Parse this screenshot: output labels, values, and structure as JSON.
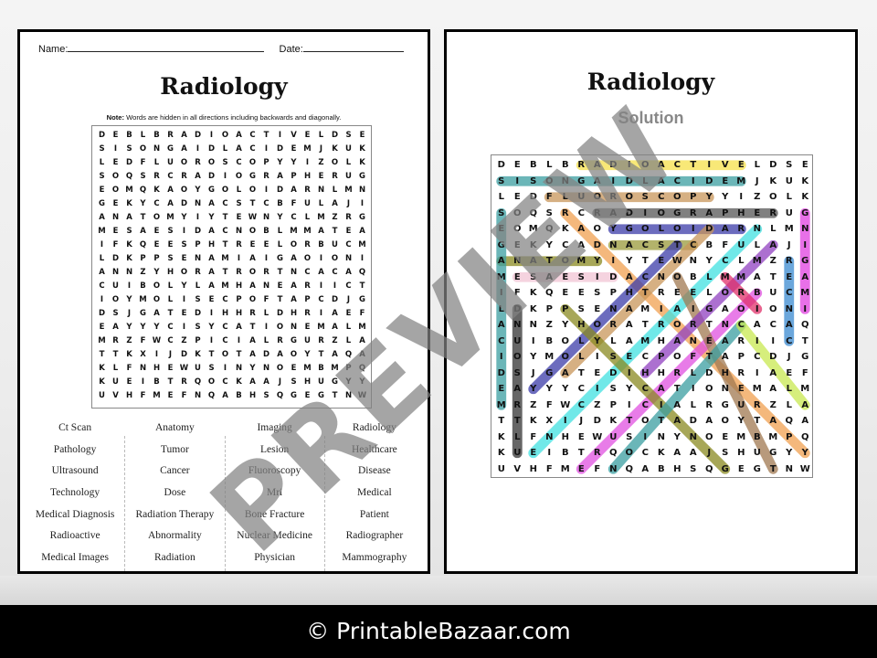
{
  "worksheet": {
    "name_label": "Name:",
    "date_label": "Date:",
    "title": "Radiology",
    "note_bold": "Note:",
    "note_text": " Words are hidden in all directions including backwards and diagonally.",
    "grid": [
      "DEBLBRADIOACTIVELDSE",
      "SISONGAIDLACIDEMJKUK",
      "LEDFLUOROSCOPYYIZOLK",
      "SOQSRCRADIOGRAPHERUG",
      "EOMQKAOYGOLOIDARNLMN",
      "GEKYCADNACSTCBFULAJI",
      "ANATOMYIYTEWNYCLMZRG",
      "MESAESIDACNOBLMMATEA",
      "IFKQEESPHTREELORBUCM",
      "LDKPPSENAMIAIGAOIONI",
      "ANNZYHORATRORTNCACAQ",
      "CUIBOLYLAMHANEARIICT",
      "IOYMOLISECPOFTAPCDJG",
      "DSJGATEDIHHRLDHRIAEF",
      "EAYYYCISYCATIONEMALM",
      "MRZFWCZPICIALRGURZLA",
      "TTKXIJDKTOTADAOYTAQA",
      "KLFNHEWUSINYNOEMBMPQ",
      "KUEIBTRQOCKAAJSHUGYY",
      "UVHFMEFNQABHSQGEGTNW"
    ],
    "word_columns": [
      [
        "Ct Scan",
        "Pathology",
        "Ultrasound",
        "Technology",
        "Medical Diagnosis",
        "Radioactive",
        "Medical Images"
      ],
      [
        "Anatomy",
        "Tumor",
        "Cancer",
        "Dose",
        "Radiation Therapy",
        "Abnormality",
        "Radiation"
      ],
      [
        "Imaging",
        "Lesion",
        "Fluoroscopy",
        "Mri",
        "Bone Fracture",
        "Nuclear Medicine",
        "Physician"
      ],
      [
        "Radiology",
        "Healthcare",
        "Disease",
        "Medical",
        "Patient",
        "Radiographer",
        "Mammography"
      ]
    ]
  },
  "solution": {
    "title": "Radiology",
    "subtitle": "Solution",
    "highlights": [
      {
        "from": [
          0,
          5
        ],
        "to": [
          0,
          15
        ],
        "color": "#f5e04a"
      },
      {
        "from": [
          1,
          15
        ],
        "to": [
          1,
          0
        ],
        "color": "#3a9ea0"
      },
      {
        "from": [
          2,
          3
        ],
        "to": [
          2,
          13
        ],
        "color": "#c8955a"
      },
      {
        "from": [
          3,
          6
        ],
        "to": [
          3,
          17
        ],
        "color": "#555555"
      },
      {
        "from": [
          4,
          15
        ],
        "to": [
          4,
          7
        ],
        "color": "#3b3ba8"
      },
      {
        "from": [
          5,
          12
        ],
        "to": [
          5,
          7
        ],
        "color": "#9a9a3a"
      },
      {
        "from": [
          6,
          0
        ],
        "to": [
          6,
          6
        ],
        "color": "#8a8a20"
      },
      {
        "from": [
          7,
          7
        ],
        "to": [
          7,
          1
        ],
        "color": "#f2c4d4"
      },
      {
        "from": [
          15,
          0
        ],
        "to": [
          3,
          0
        ],
        "color": "#3a9ea0"
      },
      {
        "from": [
          9,
          19
        ],
        "to": [
          3,
          19
        ],
        "color": "#e040e0"
      },
      {
        "from": [
          11,
          18
        ],
        "to": [
          6,
          18
        ],
        "color": "#3a8ad0"
      },
      {
        "from": [
          18,
          1
        ],
        "to": [
          9,
          1
        ],
        "color": "#333333"
      },
      {
        "from": [
          3,
          4
        ],
        "to": [
          18,
          19
        ],
        "color": "#f0a050"
      },
      {
        "from": [
          5,
          11
        ],
        "to": [
          14,
          2
        ],
        "color": "#3b3ba8"
      },
      {
        "from": [
          4,
          16
        ],
        "to": [
          18,
          2
        ],
        "color": "#40e0e0"
      },
      {
        "from": [
          8,
          16
        ],
        "to": [
          19,
          5
        ],
        "color": "#e050e0"
      },
      {
        "from": [
          4,
          13
        ],
        "to": [
          13,
          4
        ],
        "color": "#c8955a"
      },
      {
        "from": [
          9,
          4
        ],
        "to": [
          19,
          14
        ],
        "color": "#8a8a20"
      },
      {
        "from": [
          7,
          11
        ],
        "to": [
          19,
          17
        ],
        "color": "#a07850"
      },
      {
        "from": [
          5,
          17
        ],
        "to": [
          13,
          9
        ],
        "color": "#9040c0"
      },
      {
        "from": [
          10,
          15
        ],
        "to": [
          19,
          7
        ],
        "color": "#3a9ea0"
      },
      {
        "from": [
          10,
          15
        ],
        "to": [
          15,
          19
        ],
        "color": "#c8e850"
      },
      {
        "from": [
          7,
          14
        ],
        "to": [
          9,
          16
        ],
        "color": "#e0306a"
      }
    ]
  },
  "watermark": "PREVIEW",
  "footer": "© PrintableBazaar.com"
}
